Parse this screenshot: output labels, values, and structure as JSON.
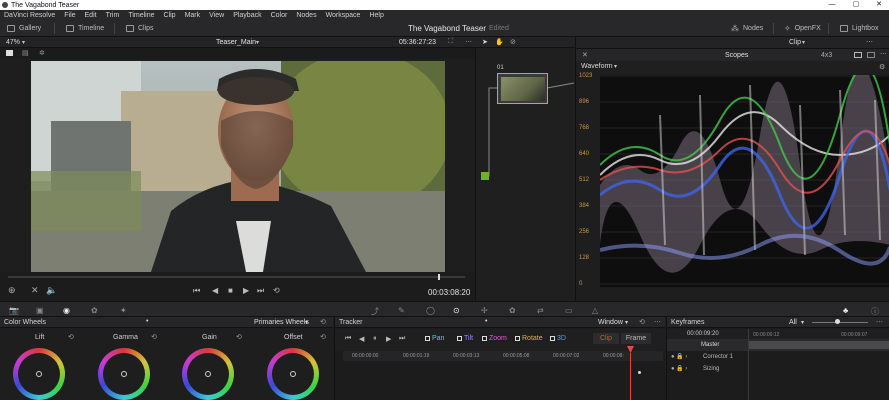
{
  "window": {
    "title": "The Vagabond Teaser",
    "min": "—",
    "max": "▢",
    "close": "✕"
  },
  "menu": [
    "DaVinci Resolve",
    "File",
    "Edit",
    "Trim",
    "Timeline",
    "Clip",
    "Mark",
    "View",
    "Playback",
    "Color",
    "Nodes",
    "Workspace",
    "Help"
  ],
  "toolbar": {
    "gallery": "Gallery",
    "timeline": "Timeline",
    "clips": "Clips",
    "project_title": "The Vagabond Teaser",
    "edited": "Edited",
    "nodes": "Nodes",
    "openfx": "OpenFX",
    "lightbox": "Lightbox"
  },
  "viewer": {
    "zoom": "47%",
    "timeline_name": "Teaser_Main",
    "source_tc": "05:36:27:23",
    "timecode": "00:03:08:20"
  },
  "nodes": {
    "node_label": "01"
  },
  "scopes": {
    "clip_select": "Clip",
    "scale": "4x3",
    "title": "Scopes",
    "mode": "Waveform",
    "y_labels": [
      "1023",
      "896",
      "768",
      "640",
      "512",
      "384",
      "256",
      "128",
      "0"
    ]
  },
  "color_wheels": {
    "title": "Color Wheels",
    "mode": "Primaries Wheels",
    "wheels": [
      "Lift",
      "Gamma",
      "Gain",
      "Offset"
    ]
  },
  "tracker": {
    "title": "Tracker",
    "mode": "Window",
    "options": [
      "Pan",
      "Tilt",
      "Zoom",
      "Rotate",
      "3D"
    ],
    "clip_btn": "Clip",
    "frame_btn": "Frame",
    "times": [
      "00:00:00:00",
      "00:00:01:19",
      "00:00:03:13",
      "00:00:05:08",
      "00:00:07:02",
      "00:00:08:"
    ]
  },
  "keyframes": {
    "title": "Keyframes",
    "filter": "All",
    "time": "00:00:09:20",
    "t1": "00:00:00:12",
    "t2": "00:00:09:07",
    "rows": [
      "Master",
      "Corrector 1",
      "Sizing"
    ]
  },
  "colors": {
    "accent": "#e04a3f",
    "scope_label": "#c99a3a"
  }
}
